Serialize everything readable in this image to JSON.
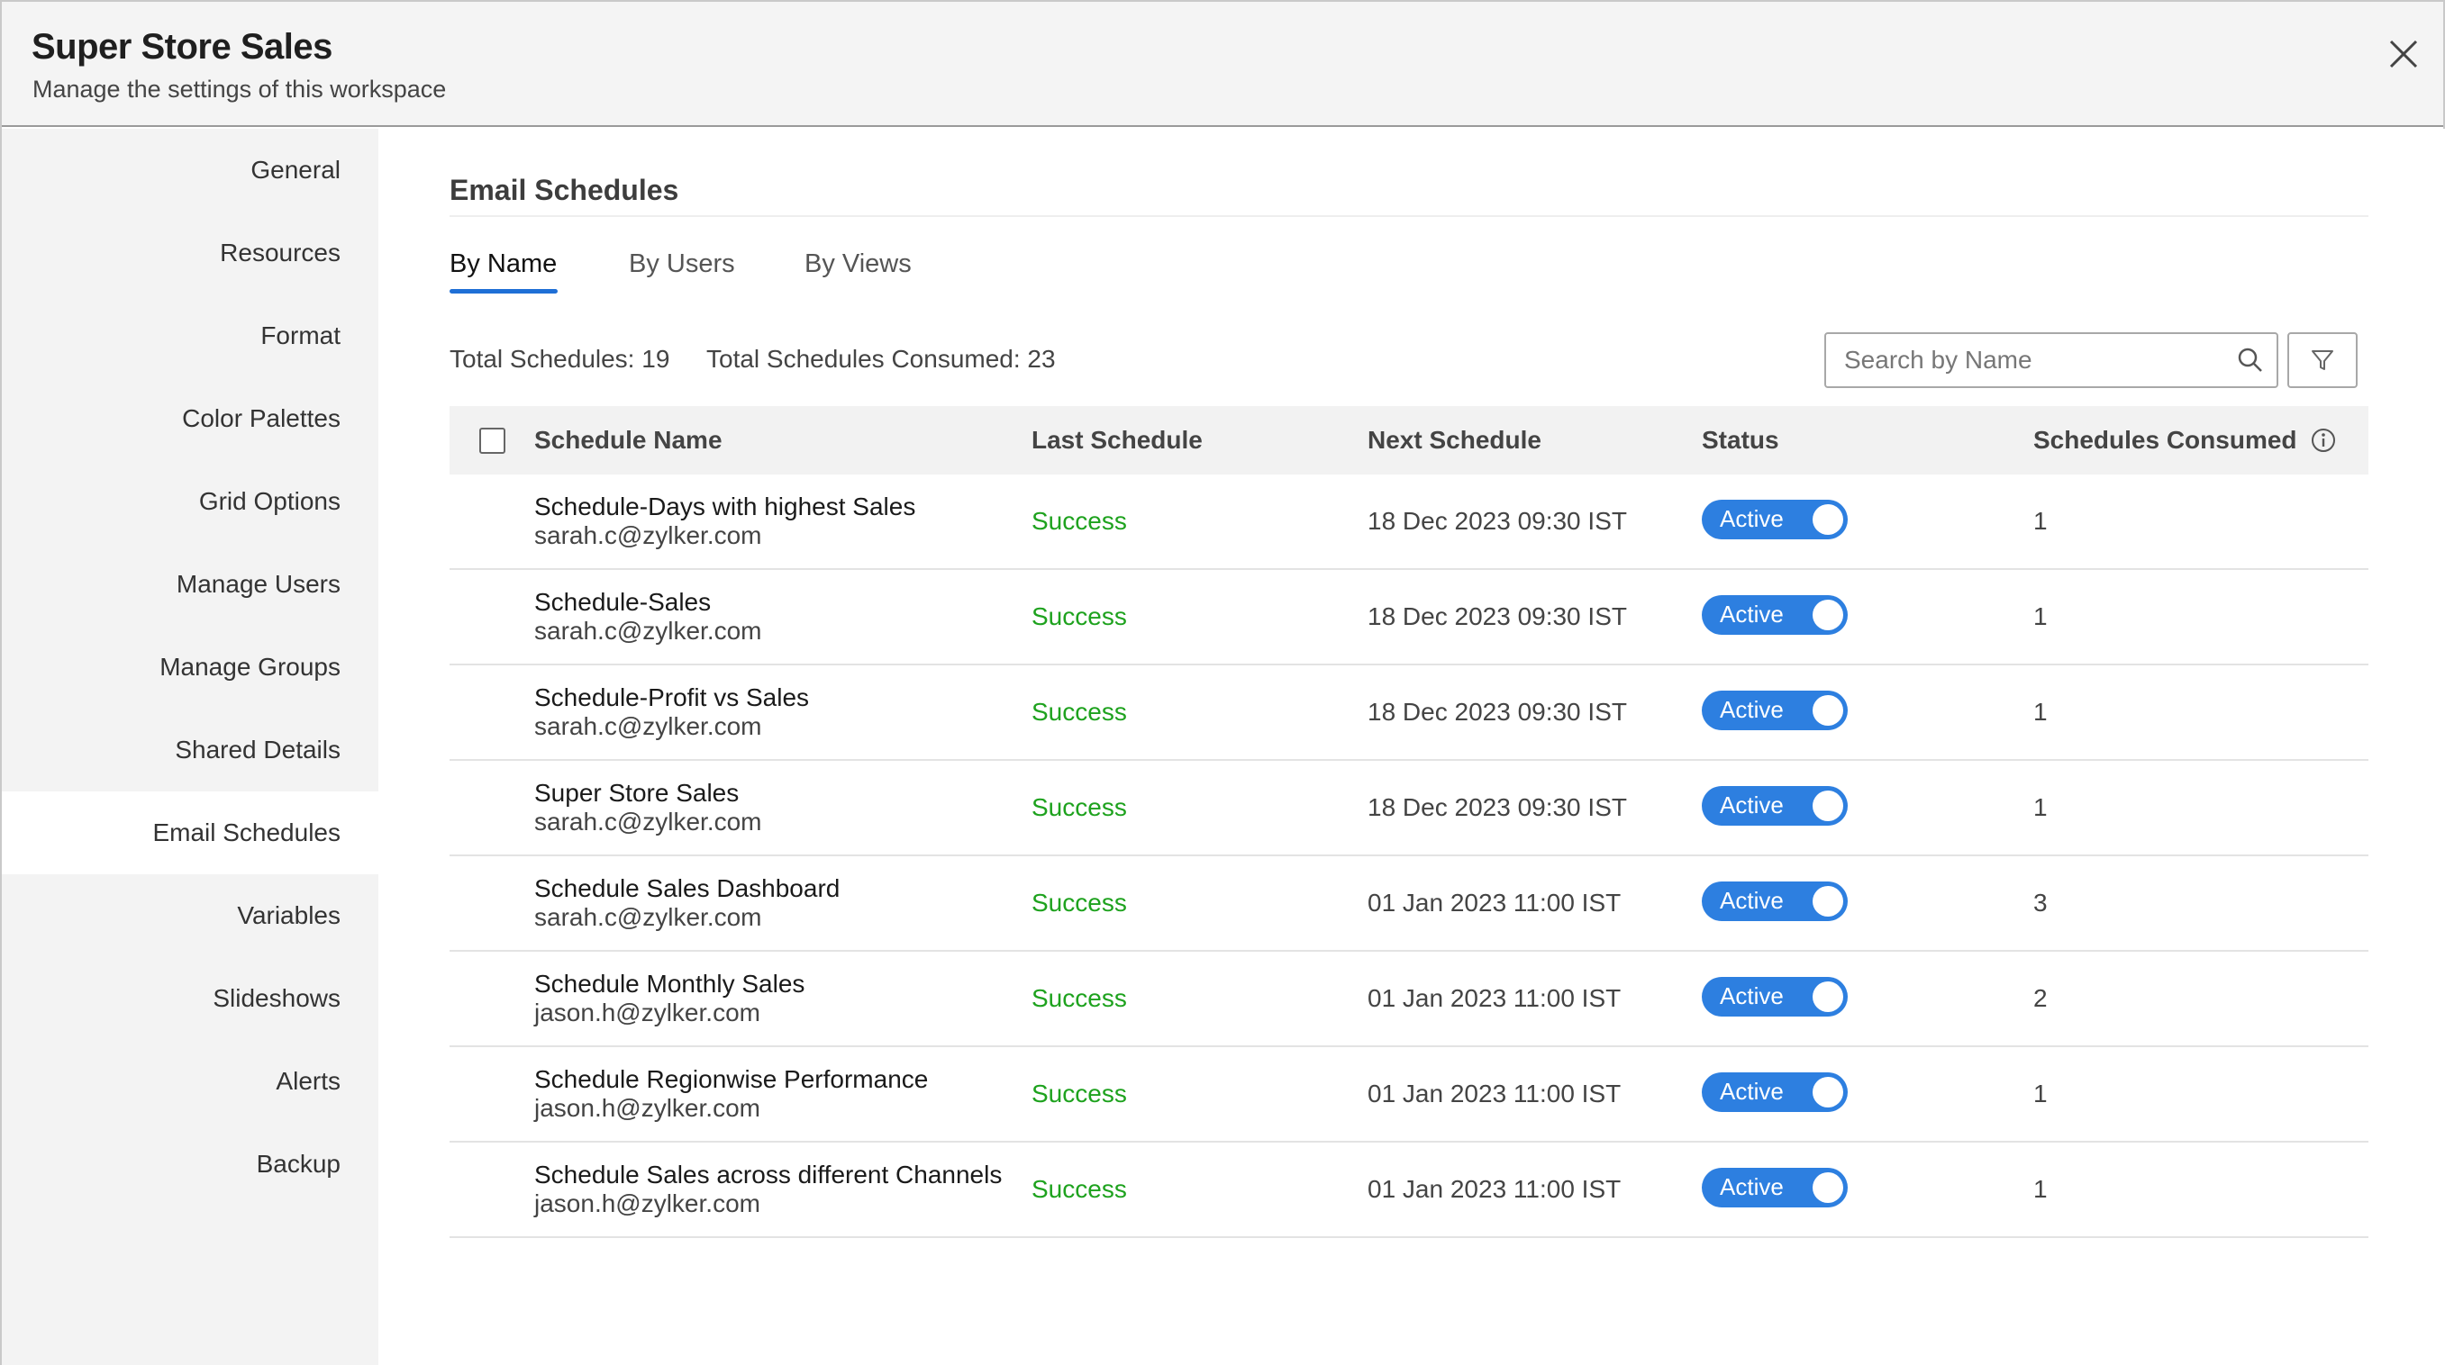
{
  "header": {
    "title": "Super Store Sales",
    "subtitle": "Manage the settings of this workspace"
  },
  "sidebar": {
    "items": [
      {
        "label": "General",
        "active": false
      },
      {
        "label": "Resources",
        "active": false
      },
      {
        "label": "Format",
        "active": false
      },
      {
        "label": "Color Palettes",
        "active": false
      },
      {
        "label": "Grid Options",
        "active": false
      },
      {
        "label": "Manage Users",
        "active": false
      },
      {
        "label": "Manage Groups",
        "active": false
      },
      {
        "label": "Shared Details",
        "active": false
      },
      {
        "label": "Email Schedules",
        "active": true
      },
      {
        "label": "Variables",
        "active": false
      },
      {
        "label": "Slideshows",
        "active": false
      },
      {
        "label": "Alerts",
        "active": false
      },
      {
        "label": "Backup",
        "active": false
      }
    ]
  },
  "main": {
    "section_title": "Email Schedules",
    "tabs": [
      {
        "label": "By Name",
        "active": true
      },
      {
        "label": "By Users",
        "active": false
      },
      {
        "label": "By Views",
        "active": false
      }
    ],
    "total_schedules": "Total Schedules: 19",
    "total_consumed": "Total Schedules Consumed: 23",
    "search": {
      "placeholder": "Search by Name",
      "value": ""
    }
  },
  "table": {
    "headers": {
      "name": "Schedule Name",
      "last": "Last Schedule",
      "next": "Next Schedule",
      "status": "Status",
      "consumed": "Schedules Consumed"
    },
    "rows": [
      {
        "name": "Schedule-Days with highest Sales",
        "email": "sarah.c@zylker.com",
        "last": "Success",
        "next": "18 Dec 2023 09:30 IST",
        "status": "Active",
        "consumed": "1"
      },
      {
        "name": "Schedule-Sales",
        "email": "sarah.c@zylker.com",
        "last": "Success",
        "next": "18 Dec 2023 09:30 IST",
        "status": "Active",
        "consumed": "1"
      },
      {
        "name": "Schedule-Profit vs Sales",
        "email": "sarah.c@zylker.com",
        "last": "Success",
        "next": "18 Dec 2023 09:30 IST",
        "status": "Active",
        "consumed": "1"
      },
      {
        "name": "Super Store Sales",
        "email": "sarah.c@zylker.com",
        "last": "Success",
        "next": "18 Dec 2023 09:30 IST",
        "status": "Active",
        "consumed": "1"
      },
      {
        "name": "Schedule Sales Dashboard",
        "email": "sarah.c@zylker.com",
        "last": "Success",
        "next": "01 Jan 2023 11:00 IST",
        "status": "Active",
        "consumed": "3"
      },
      {
        "name": "Schedule Monthly Sales",
        "email": "jason.h@zylker.com",
        "last": "Success",
        "next": "01 Jan 2023 11:00 IST",
        "status": "Active",
        "consumed": "2"
      },
      {
        "name": "Schedule Regionwise Performance",
        "email": "jason.h@zylker.com",
        "last": "Success",
        "next": "01 Jan 2023 11:00 IST",
        "status": "Active",
        "consumed": "1"
      },
      {
        "name": "Schedule Sales across different Channels",
        "email": "jason.h@zylker.com",
        "last": "Success",
        "next": "01 Jan 2023 11:00 IST",
        "status": "Active",
        "consumed": "1"
      }
    ]
  },
  "colors": {
    "accent": "#2d7fe0",
    "success": "#1ea21e",
    "tab_underline": "#1f6fd6"
  }
}
